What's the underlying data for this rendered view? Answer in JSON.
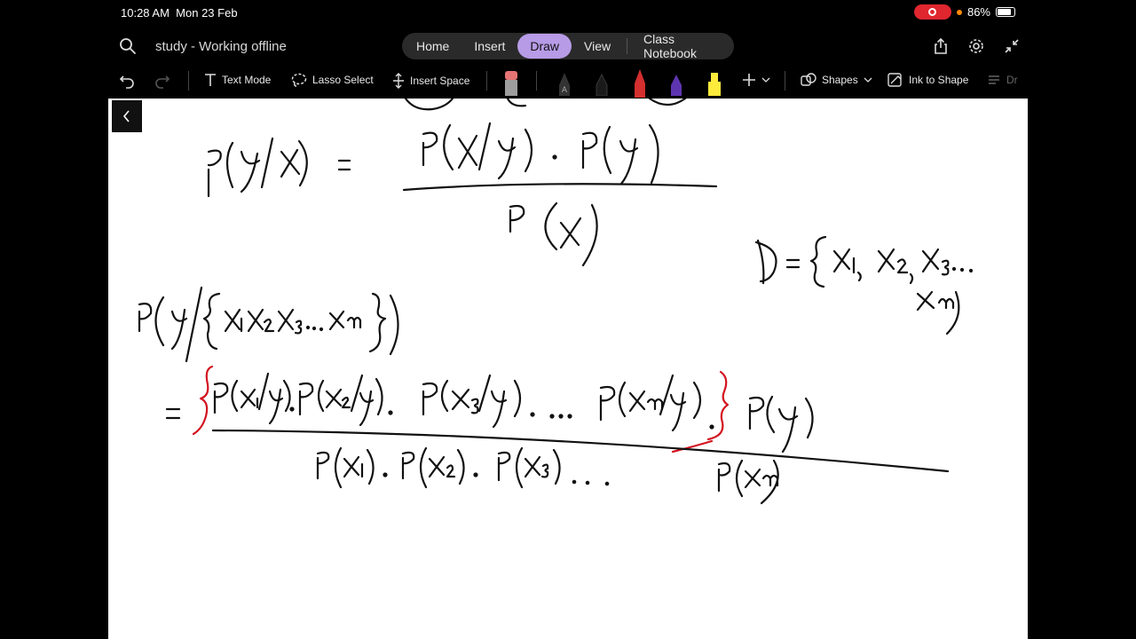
{
  "status": {
    "time": "10:28 AM",
    "date": "Mon 23 Feb",
    "battery": "86%",
    "battery_level": 0.86
  },
  "title_bar": {
    "doc_title": "study - Working offline",
    "tabs": [
      {
        "label": "Home"
      },
      {
        "label": "Insert"
      },
      {
        "label": "Draw",
        "active": true
      },
      {
        "label": "View"
      }
    ],
    "class_notebook": "Class Notebook"
  },
  "toolbar": {
    "text_mode": "Text Mode",
    "lasso_select": "Lasso Select",
    "insert_space": "Insert Space",
    "shapes": "Shapes",
    "ink_to_shape": "Ink to Shape",
    "overflow": "Dr",
    "pen_colors": [
      "#e57373",
      "#333333",
      "#1a1a1a",
      "#d32f2f",
      "#5e35b1",
      "#ffeb3b"
    ]
  },
  "colors": {
    "accent": "#b79be6",
    "ink_black": "#111111",
    "ink_red": "#d3131f"
  }
}
